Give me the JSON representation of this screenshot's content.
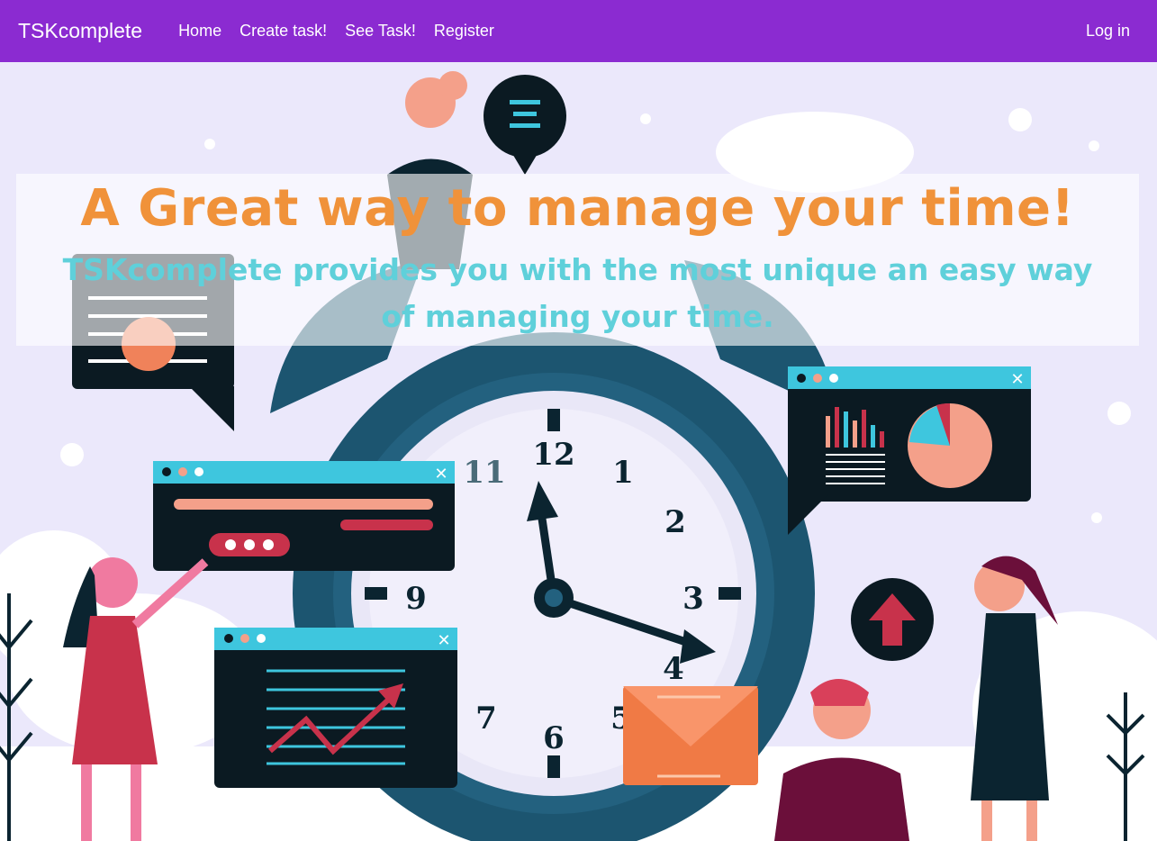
{
  "nav": {
    "brand": "TSKcomplete",
    "links": [
      "Home",
      "Create task!",
      "See Task!",
      "Register"
    ],
    "login": "Log in"
  },
  "hero": {
    "headline": "A Great way to manage your time!",
    "subline": "TSKcomplete provides you with the most unique an easy way of managing your time."
  },
  "illustration": {
    "clock_numbers": [
      "12",
      "1",
      "2",
      "3",
      "4",
      "5",
      "6",
      "7",
      "9",
      "11"
    ],
    "icons": [
      "lock-icon",
      "chat-bubble-icon",
      "up-arrow-icon",
      "envelope-icon",
      "close-icon",
      "chart-icon"
    ]
  },
  "colors": {
    "navbar": "#8b2bd1",
    "background": "#ebe8fb",
    "headline": "#f0923a",
    "subline": "#5fd0da"
  }
}
